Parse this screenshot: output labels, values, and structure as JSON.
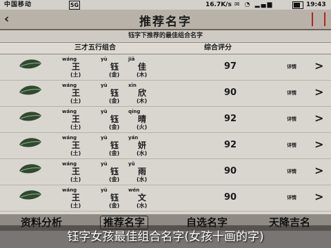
{
  "status_bar": {
    "carrier": "中国移动",
    "sim": "5G",
    "speed": "16.7K/s",
    "time": "19:43"
  },
  "title_bar": {
    "title": "推荐名字"
  },
  "subtitle": "钰字下推荐的最佳组合名字",
  "list_header": {
    "combo": "三才五行组合",
    "score": "综合评分"
  },
  "rows": [
    {
      "pinyin": [
        "wáng",
        "yù",
        "jiā"
      ],
      "chars": [
        "王",
        "钰",
        "佳"
      ],
      "elements": [
        "土",
        "金",
        "木"
      ],
      "score": "97",
      "detail": "详情"
    },
    {
      "pinyin": [
        "wáng",
        "yù",
        "xīn"
      ],
      "chars": [
        "王",
        "钰",
        "欣"
      ],
      "elements": [
        "土",
        "金",
        "木"
      ],
      "score": "90",
      "detail": "详情"
    },
    {
      "pinyin": [
        "wáng",
        "yù",
        "qíng"
      ],
      "chars": [
        "王",
        "钰",
        "晴"
      ],
      "elements": [
        "土",
        "金",
        "火"
      ],
      "score": "92",
      "detail": "详情"
    },
    {
      "pinyin": [
        "wáng",
        "yù",
        "yán"
      ],
      "chars": [
        "王",
        "钰",
        "妍"
      ],
      "elements": [
        "土",
        "金",
        "水"
      ],
      "score": "92",
      "detail": "详情"
    },
    {
      "pinyin": [
        "wáng",
        "yù",
        "yǔ"
      ],
      "chars": [
        "王",
        "钰",
        "雨"
      ],
      "elements": [
        "土",
        "金",
        "水"
      ],
      "score": "90",
      "detail": "详情"
    },
    {
      "pinyin": [
        "wáng",
        "yù",
        "wén"
      ],
      "chars": [
        "王",
        "钰",
        "文"
      ],
      "elements": [
        "土",
        "金",
        "水"
      ],
      "score": "90",
      "detail": "详情"
    }
  ],
  "tabs": {
    "info": "资料分析",
    "recommend": "推荐名字",
    "custom": "自选名字",
    "tianjiang": "天降吉名"
  },
  "caption": "钰字女孩最佳组合名字(女孩十画的字)",
  "colors": {
    "title_bar": "#b8b2a8",
    "tab_bar": "#8f8a83",
    "accent_red": "#b3261e",
    "leaf_green": "#2f4a2f"
  }
}
